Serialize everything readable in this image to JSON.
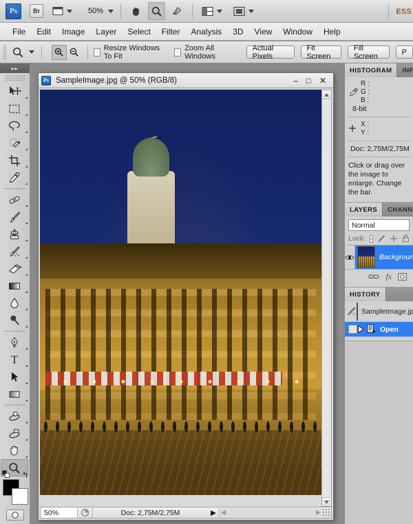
{
  "app": {
    "logo": "Ps",
    "bridge_logo": "Br",
    "zoom_level": "50%",
    "workspace_label": "ESS"
  },
  "menu": {
    "items": [
      "File",
      "Edit",
      "Image",
      "Layer",
      "Select",
      "Filter",
      "Analysis",
      "3D",
      "View",
      "Window",
      "Help"
    ]
  },
  "options_bar": {
    "tool": "zoom-tool",
    "checkboxes": [
      {
        "label": "Resize Windows To Fit",
        "checked": false
      },
      {
        "label": "Zoom All Windows",
        "checked": false
      }
    ],
    "buttons": [
      "Actual Pixels",
      "Fit Screen",
      "Fill Screen",
      "P"
    ]
  },
  "toolbox": {
    "tools": [
      {
        "name": "move-tool",
        "selected": false
      },
      {
        "name": "rectangular-marquee-tool",
        "selected": false
      },
      {
        "name": "lasso-tool",
        "selected": false
      },
      {
        "name": "quick-selection-tool",
        "selected": false
      },
      {
        "name": "crop-tool",
        "selected": false
      },
      {
        "name": "eyedropper-tool",
        "selected": false
      },
      {
        "name": "spot-healing-brush-tool",
        "selected": false
      },
      {
        "name": "brush-tool",
        "selected": false
      },
      {
        "name": "clone-stamp-tool",
        "selected": false
      },
      {
        "name": "history-brush-tool",
        "selected": false
      },
      {
        "name": "eraser-tool",
        "selected": false
      },
      {
        "name": "gradient-tool",
        "selected": false
      },
      {
        "name": "blur-tool",
        "selected": false
      },
      {
        "name": "dodge-tool",
        "selected": false
      },
      {
        "name": "pen-tool",
        "selected": false
      },
      {
        "name": "horizontal-type-tool",
        "selected": false
      },
      {
        "name": "path-selection-tool",
        "selected": false
      },
      {
        "name": "rectangle-tool",
        "selected": false
      },
      {
        "name": "3d-object-rotate-tool",
        "selected": false
      },
      {
        "name": "3d-camera-rotate-tool",
        "selected": false
      },
      {
        "name": "hand-tool",
        "selected": false
      },
      {
        "name": "zoom-tool",
        "selected": true
      }
    ],
    "foreground_color": "#000000",
    "background_color": "#ffffff",
    "type_label": "T"
  },
  "document": {
    "title": "SampleImage.jpg @ 50% (RGB/8)",
    "filename": "SampleImage.jpg",
    "zoom": "50%",
    "color_mode": "RGB/8",
    "minimize_glyph": "–",
    "maximize_glyph": "□",
    "close_glyph": "✕",
    "status": {
      "zoom_value": "50%",
      "doc_info": "Doc: 2,75M/2,75M",
      "arrow_glyph": "▶"
    }
  },
  "panels": {
    "histogram": {
      "tabs": [
        {
          "label": "HISTOGRAM",
          "active": true
        },
        {
          "label": "INFO",
          "active": false
        }
      ],
      "channels": [
        "R :",
        "G :",
        "B :"
      ],
      "bit_depth": "8-bit",
      "coords": [
        "X :",
        "Y :"
      ],
      "doc_size": "Doc: 2,75M/2,75M",
      "hint": "Click or drag over the image to enlarge. Change the bar."
    },
    "layers": {
      "tabs": [
        {
          "label": "LAYERS",
          "active": true
        },
        {
          "label": "CHANNELS",
          "active": false
        }
      ],
      "blend_mode": "Normal",
      "lock_label": "Lock:",
      "rows": [
        {
          "name": "Background",
          "visible": true,
          "selected": true
        }
      ],
      "footer_icons": [
        "link-icon",
        "fx-icon",
        "mask-icon"
      ]
    },
    "history": {
      "tabs": [
        {
          "label": "HISTORY",
          "active": true
        }
      ],
      "rows": [
        {
          "label": "SampleImage.jpg",
          "selected": false,
          "type": "snapshot"
        },
        {
          "label": "Open",
          "selected": true,
          "type": "state"
        }
      ]
    }
  },
  "colors": {
    "accent": "#2e7ef0",
    "chrome": "#d2d2d2",
    "workspace_bg": "#8a8a8a",
    "workspace_text": "#a85a16"
  }
}
